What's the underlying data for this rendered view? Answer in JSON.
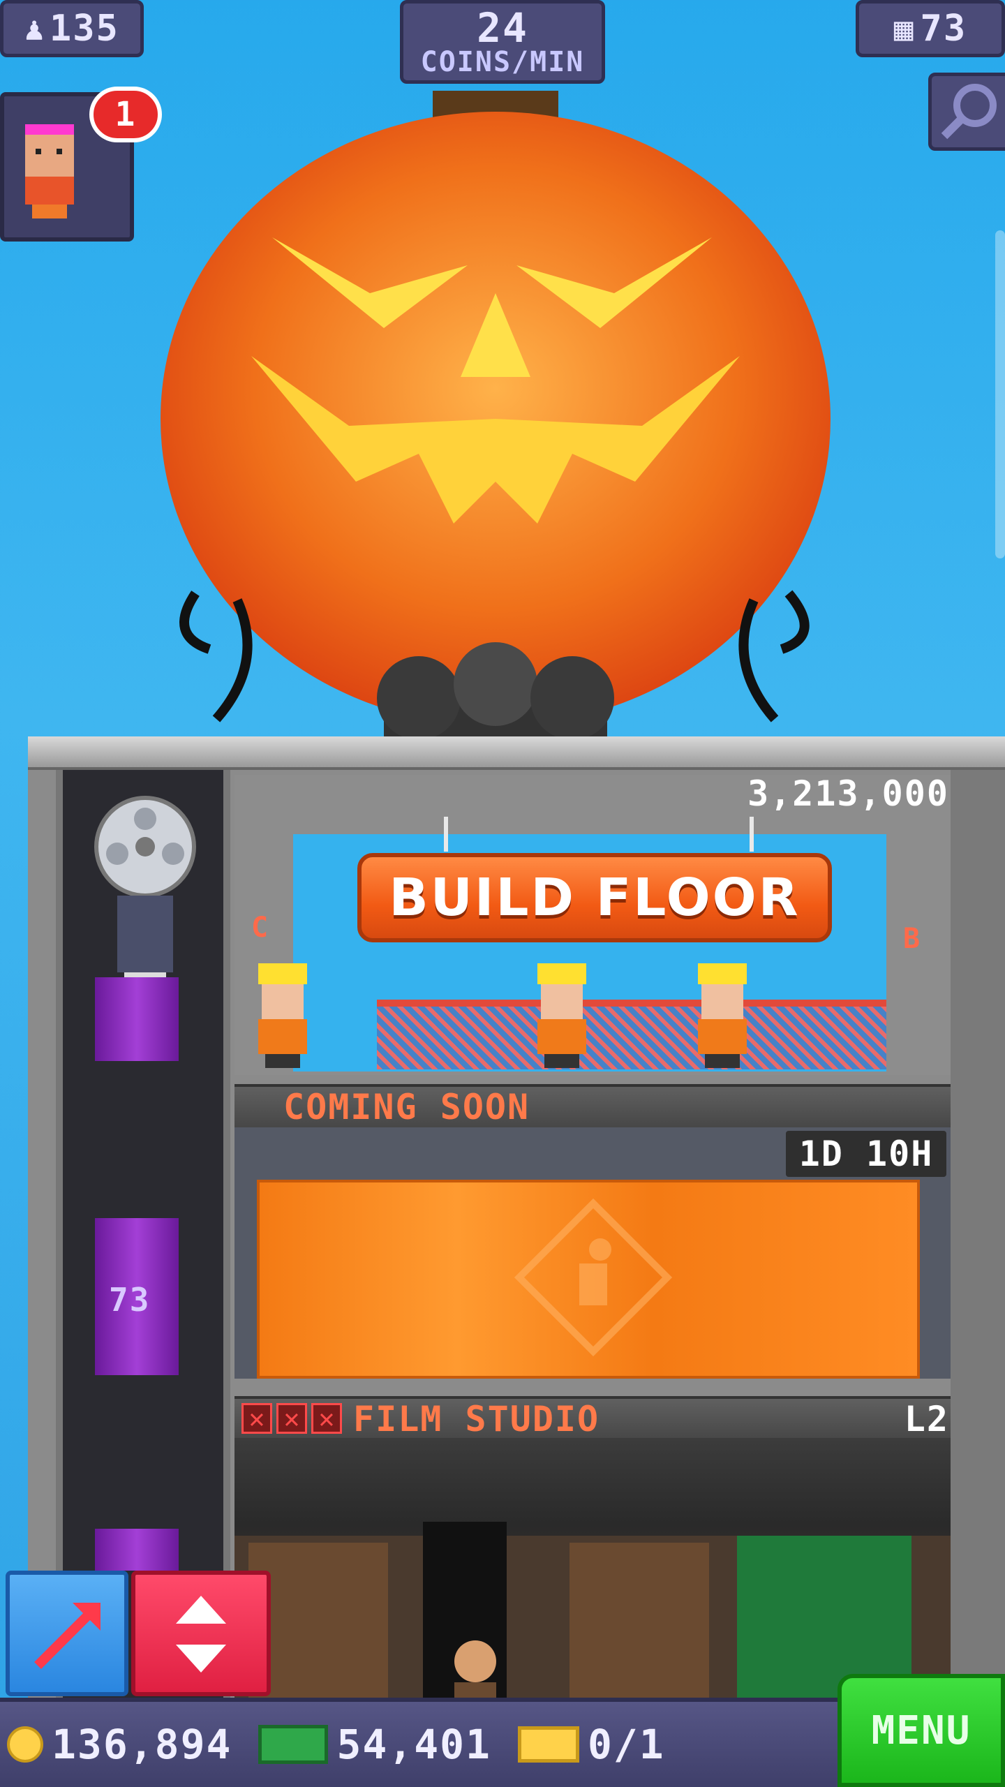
{
  "hud": {
    "population": "135",
    "coins_per_min_value": "24",
    "coins_per_min_unit": "COINS/MIN",
    "floors": "73",
    "visitor_badge_count": "1"
  },
  "tower": {
    "build_floor": {
      "cost": "3,213,000",
      "button_label": "BUILD FLOOR",
      "sign_left": "C",
      "sign_right": "B"
    },
    "coming_soon": {
      "label": "COMING SOON",
      "timer": "1D 10H"
    },
    "film_studio": {
      "label": "FILM STUDIO",
      "level": "L2",
      "stars_empty": 3
    },
    "elevator_floor_number": "73"
  },
  "bottom_bar": {
    "coins": "136,894",
    "bux": "54,401",
    "tickets": "0/1",
    "menu_label": "MENU"
  },
  "colors": {
    "sky": "#27a9ec",
    "hud_bg": "#4b4b78",
    "build_button": "#f25a14",
    "menu_green": "#1bb61b",
    "tarp_orange": "#f47a14"
  }
}
